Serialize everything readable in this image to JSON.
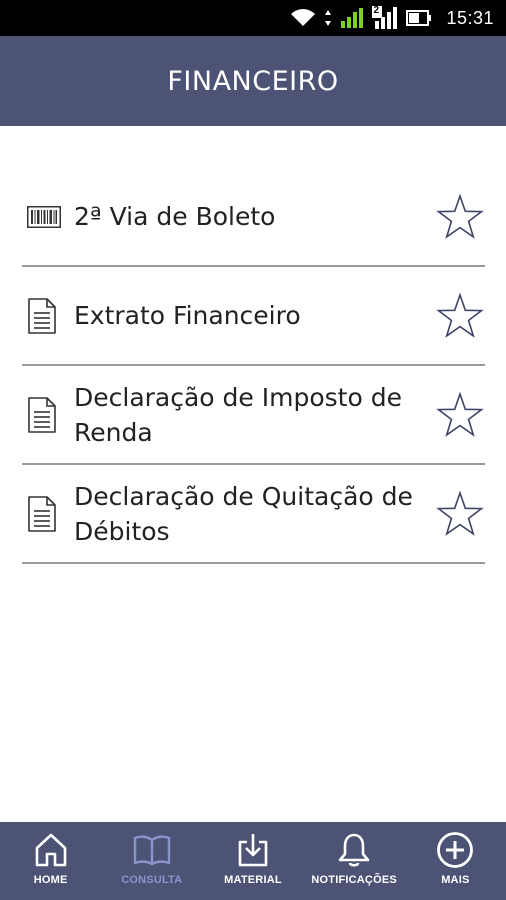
{
  "status_bar": {
    "time": "15:31",
    "sim_badge": "2"
  },
  "header": {
    "title": "FINANCEIRO"
  },
  "list": {
    "items": [
      {
        "label": "2ª Via de Boleto",
        "icon": "barcode-icon"
      },
      {
        "label": "Extrato Financeiro",
        "icon": "document-icon"
      },
      {
        "label": "Declaração de Imposto de Renda",
        "icon": "document-icon"
      },
      {
        "label": "Declaração de Quitação de Débitos",
        "icon": "document-icon"
      }
    ]
  },
  "bottom_nav": {
    "active": "consulta",
    "active_color": "#8a94cc",
    "items": [
      {
        "label": "HOME",
        "icon": "home-icon"
      },
      {
        "label": "CONSULTA",
        "icon": "book-icon"
      },
      {
        "label": "MATERIAL",
        "icon": "download-icon"
      },
      {
        "label": "NOTIFICAÇÕES",
        "icon": "bell-icon"
      },
      {
        "label": "MAIS",
        "icon": "plus-circle-icon"
      }
    ]
  },
  "colors": {
    "header_bg": "#4c5375",
    "divider": "#9a9a9a",
    "text": "#222222"
  }
}
